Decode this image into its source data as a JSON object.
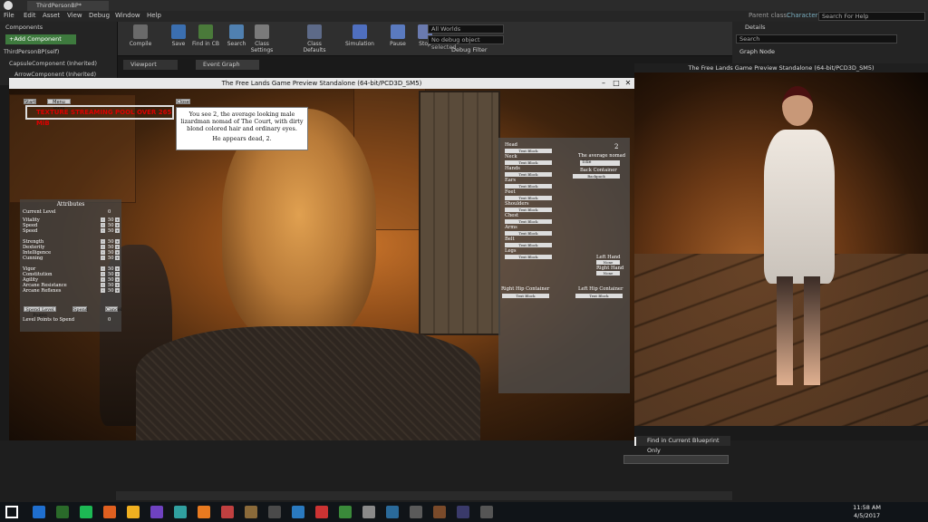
{
  "editor": {
    "tab_title": "ThirdPersonBP*",
    "menu": [
      "File",
      "Edit",
      "Asset",
      "View",
      "Debug",
      "Window",
      "Help"
    ],
    "parent_class_label": "Parent class:",
    "parent_class_value": "Character",
    "search_help_placeholder": "Search For Help",
    "toolbar": [
      {
        "label": "Compile",
        "color": "#6a6a6a"
      },
      {
        "label": "Save",
        "color": "#3b6fb0"
      },
      {
        "label": "Find in CB",
        "color": "#4a7a3a"
      },
      {
        "label": "Search",
        "color": "#5080b0"
      },
      {
        "label": "Class Settings",
        "color": "#7a7a7a"
      },
      {
        "label": "Class Defaults",
        "color": "#5d6a88"
      },
      {
        "label": "Simulation",
        "color": "#4f6fbf"
      },
      {
        "label": "Pause",
        "color": "#5a7abf"
      },
      {
        "label": "Stop",
        "color": "#6a7aaf"
      }
    ],
    "world_select": "All Worlds",
    "debug_select": "No debug object selected",
    "debug_filter_label": "Debug Filter",
    "components_header": "Components",
    "add_component_label": "+Add Component",
    "component_items": [
      "ThirdPersonBP(self)",
      "CapsuleComponent (Inherited)",
      "ArrowComponent (Inherited)"
    ],
    "details_header": "Details",
    "details_search_placeholder": "Search",
    "graph_node_label": "Graph Node",
    "viewport_tab": "Viewport",
    "event_graph_tab": "Event Graph",
    "find_in_blueprint": "Find in Current Blueprint Only"
  },
  "preview": {
    "title": "The Free Lands Game Preview Standalone (64-bit/PCD3D_SM5)",
    "right_title": "The Free Lands Game Preview Standalone (64-bit/PCD3D_SM5)",
    "texture_warning": "TEXTURE STREAMING POOL OVER 265 MiB",
    "small_buttons": [
      "Start",
      "Menu Build",
      "Close"
    ]
  },
  "dialog": {
    "text": "You see 2, the average looking male lizardman nomad of The Court, with dirty blond colored hair and ordinary eyes.",
    "status": "He appears dead, 2."
  },
  "attributes": {
    "title": "Attributes",
    "current_level_label": "Current Level",
    "current_level_value": "0",
    "rows": [
      {
        "name": "Vitality",
        "value": "50"
      },
      {
        "name": "Speed",
        "value": "50"
      },
      {
        "name": "Speed",
        "value": "50"
      },
      {
        "name": "Strength",
        "value": "50"
      },
      {
        "name": "Dexterity",
        "value": "50"
      },
      {
        "name": "Intelligence",
        "value": "50"
      },
      {
        "name": "Cunning",
        "value": "50"
      },
      {
        "name": "Vigor",
        "value": "50"
      },
      {
        "name": "Constitution",
        "value": "50"
      },
      {
        "name": "Agility",
        "value": "50"
      },
      {
        "name": "Arcane Resistance",
        "value": "50"
      },
      {
        "name": "Arcane Reflexes",
        "value": "50"
      }
    ],
    "buttons": [
      "Spend Level Points",
      "Spend",
      "Cancel"
    ],
    "points_label": "Level Points to Spend",
    "points_value": "0"
  },
  "equipment": {
    "level_value": "2",
    "name_label": "The average nomad",
    "title_select": "Title",
    "back_container_label": "Back Container",
    "backpack_label": "Backpack",
    "slot_button": "Text Block",
    "slots": [
      "Head",
      "Neck",
      "Hands",
      "Ears",
      "Feet",
      "Shoulders",
      "Chest",
      "Arms",
      "Belt",
      "Legs"
    ],
    "left_hand_label": "Left Hand",
    "right_hand_label": "Right Hand",
    "hand_buttons": [
      "None",
      "None"
    ],
    "right_hip_label": "Right Hip Container",
    "left_hip_label": "Left Hip Container"
  },
  "taskbar": {
    "time": "11:58 AM",
    "date": "4/5/2017",
    "icons": [
      "#1f6fcf",
      "#2a6a2a",
      "#1db954",
      "#e06020",
      "#f0b020",
      "#6f42c1",
      "#30a0a0",
      "#e87a20",
      "#c04040",
      "#8a6a3a",
      "#4a4a4a",
      "#2a7ac0",
      "#cc3333",
      "#3a8a3a",
      "#8a8a8a",
      "#2a6a9a",
      "#5a5a5a",
      "#7a4a2a",
      "#3a3a6a",
      "#555555"
    ]
  }
}
